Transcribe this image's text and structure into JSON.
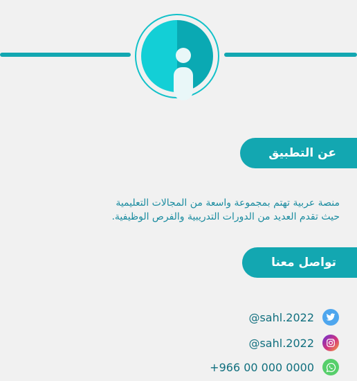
{
  "header": {
    "icon": "info-icon"
  },
  "about": {
    "title": "عن التطبيق",
    "line1": "منصة عربية تهتم بمجموعة واسعة من المجالات التعليمية",
    "line2": "حيث تقدم العديد من الدورات التدريبية والفرص الوظيفية."
  },
  "contact": {
    "title": "تواصل معنا",
    "items": [
      {
        "icon": "twitter-icon",
        "text": "@sahl.2022",
        "color": "#4ea6ee"
      },
      {
        "icon": "instagram-icon",
        "text": "@sahl.2022",
        "color": "#d2357e"
      },
      {
        "icon": "whatsapp-icon",
        "text": "+966 00 000 0000",
        "color": "#57cf6b"
      }
    ]
  },
  "colors": {
    "accent": "#13a7b1",
    "text": "#1b8ca0",
    "background": "#f1f1f1"
  }
}
